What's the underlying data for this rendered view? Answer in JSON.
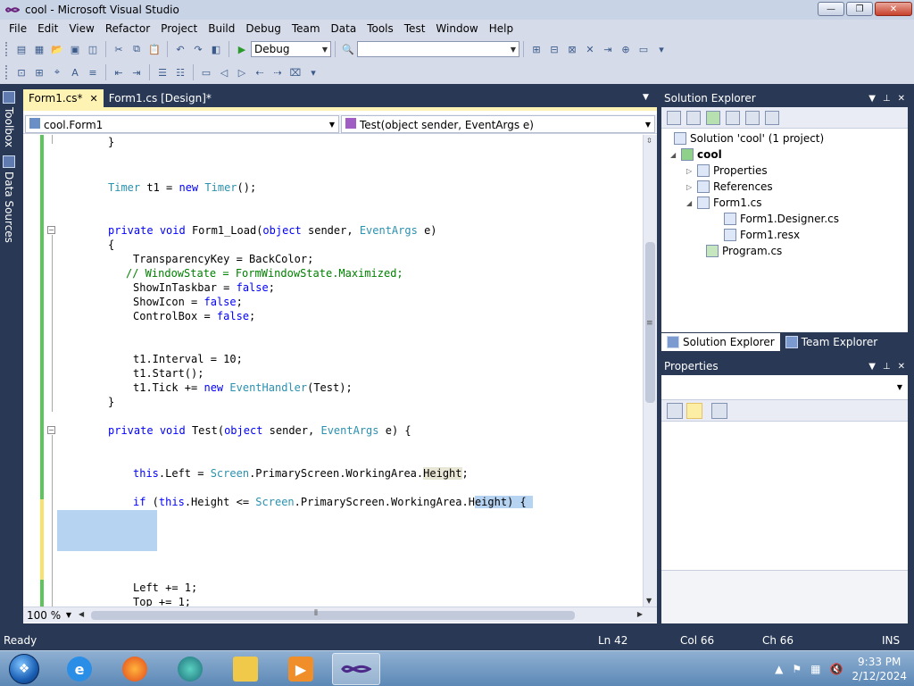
{
  "window": {
    "title": "cool - Microsoft Visual Studio"
  },
  "menu": [
    "File",
    "Edit",
    "View",
    "Refactor",
    "Project",
    "Build",
    "Debug",
    "Team",
    "Data",
    "Tools",
    "Test",
    "Window",
    "Help"
  ],
  "toolbar": {
    "configuration": "Debug",
    "search_value": ""
  },
  "left_rail": {
    "toolbox": "Toolbox",
    "data_sources": "Data Sources"
  },
  "editor": {
    "tabs": [
      {
        "label": "Form1.cs*",
        "close": "✕"
      },
      {
        "label": "Form1.cs [Design]*"
      }
    ],
    "nav_class": "cool.Form1",
    "nav_member": "Test(object sender, EventArgs e)",
    "zoom": "100 %"
  },
  "solution_explorer": {
    "title": "Solution Explorer",
    "nodes": [
      "Solution 'cool' (1 project)",
      "cool",
      "Properties",
      "References",
      "Form1.cs",
      "Form1.Designer.cs",
      "Form1.resx",
      "Program.cs"
    ],
    "tabs": [
      "Solution Explorer",
      "Team Explorer"
    ]
  },
  "properties": {
    "title": "Properties"
  },
  "status": {
    "state": "Ready",
    "line": "Ln 42",
    "col": "Col 66",
    "ch": "Ch 66",
    "mode": "INS"
  },
  "clock": {
    "time": "9:33 PM",
    "date": "2/12/2024"
  },
  "colors": {
    "chrome": "#293955",
    "active_tab": "#fff3b3",
    "selection": "#b7d3f2",
    "keyword": "#0000ff",
    "type": "#2b91af",
    "comment": "#008000"
  }
}
